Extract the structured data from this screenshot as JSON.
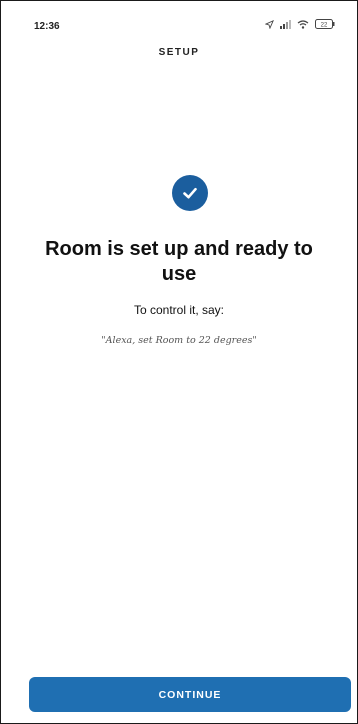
{
  "status_bar": {
    "time": "12:36",
    "icons": [
      "location-icon",
      "signal-icon",
      "wifi-icon",
      "battery-icon"
    ],
    "battery_level": "22"
  },
  "header": {
    "title": "SETUP"
  },
  "content": {
    "check_icon": "check-circle-icon",
    "title": "Room is set up and ready to use",
    "subtitle": "To control it, say:",
    "example_phrase": "\"Alexa, set Room to 22 degrees\""
  },
  "footer": {
    "continue_label": "CONTINUE"
  },
  "colors": {
    "accent": "#1f6fb2",
    "check_bg": "#1b5e9e",
    "text": "#111111",
    "muted": "#555555"
  }
}
